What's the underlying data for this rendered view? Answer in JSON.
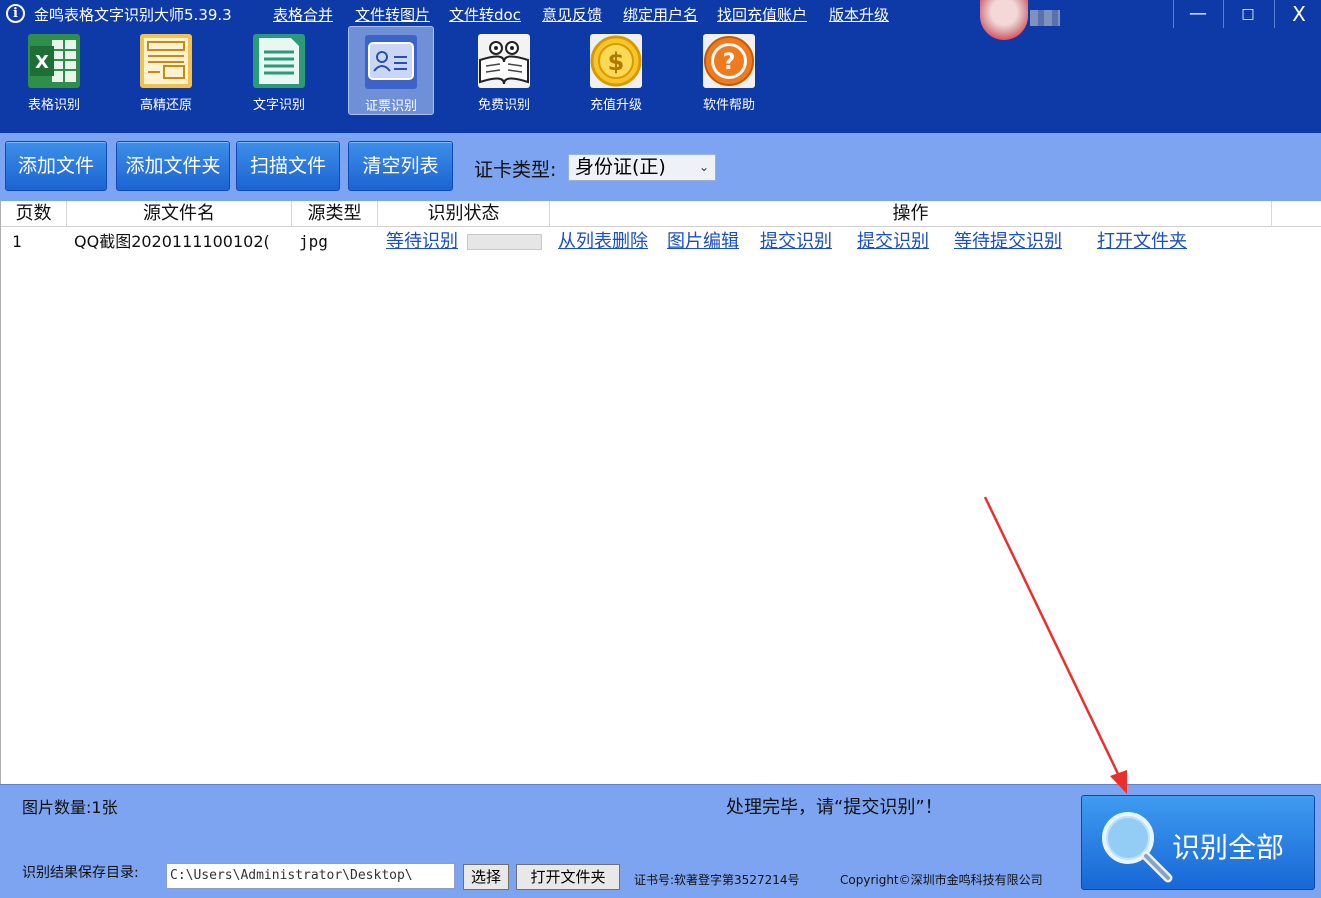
{
  "title_bar": {
    "app_title": "金鸣表格文字识别大师5.39.3",
    "info_icon": "info-icon",
    "menu": [
      {
        "label": "表格合并"
      },
      {
        "label": "文件转图片"
      },
      {
        "label": "文件转doc"
      },
      {
        "label": "意见反馈"
      },
      {
        "label": "绑定用户名"
      },
      {
        "label": "找回充值账户"
      },
      {
        "label": "版本升级"
      }
    ],
    "window_controls": {
      "minimize": "—",
      "maximize": "□",
      "close": "X"
    }
  },
  "toolbar": {
    "items": [
      {
        "label": "表格识别",
        "icon": "excel-icon"
      },
      {
        "label": "高精还原",
        "icon": "layout-restore-icon"
      },
      {
        "label": "文字识别",
        "icon": "text-document-icon"
      },
      {
        "label": "证票识别",
        "icon": "id-card-icon",
        "active": true
      },
      {
        "label": "免费识别",
        "icon": "book-reading-icon"
      },
      {
        "label": "充值升级",
        "icon": "coin-icon"
      },
      {
        "label": "软件帮助",
        "icon": "help-icon"
      }
    ]
  },
  "action_bar": {
    "buttons": [
      {
        "label": "添加文件"
      },
      {
        "label": "添加文件夹"
      },
      {
        "label": "扫描文件"
      },
      {
        "label": "清空列表"
      }
    ],
    "card_type_label": "证卡类型:",
    "card_type_value": "身份证(正)"
  },
  "file_table": {
    "columns": [
      "页数",
      "源文件名",
      "源类型",
      "识别状态",
      "操作"
    ],
    "rows": [
      {
        "page": "1",
        "file_name": "QQ截图2020111100102(",
        "file_type": "jpg",
        "status": "等待识别",
        "progress": 0,
        "actions": [
          "从列表删除",
          "图片编辑",
          "提交识别",
          "提交识别",
          "等待提交识别",
          "打开文件夹"
        ]
      }
    ]
  },
  "footer": {
    "image_count": "图片数量:1张",
    "status_message": "处理完毕，请“提交识别”！",
    "save_dir_label": "识别结果保存目录:",
    "save_dir_value": "C:\\Users\\Administrator\\Desktop\\",
    "choose_button": "选择",
    "open_folder_button": "打开文件夹",
    "cert_no": "证书号:软著登字第3527214号",
    "copyright": "Copyright©深圳市金鸣科技有限公司",
    "recognize_all_button": "识别全部"
  },
  "colors": {
    "title_bg": "#0d3aa7",
    "panel_bg": "#7da4f1",
    "button_blue": "#1c63d3",
    "link_blue": "#1a4fc0",
    "annotation_arrow": "#e8312f"
  }
}
